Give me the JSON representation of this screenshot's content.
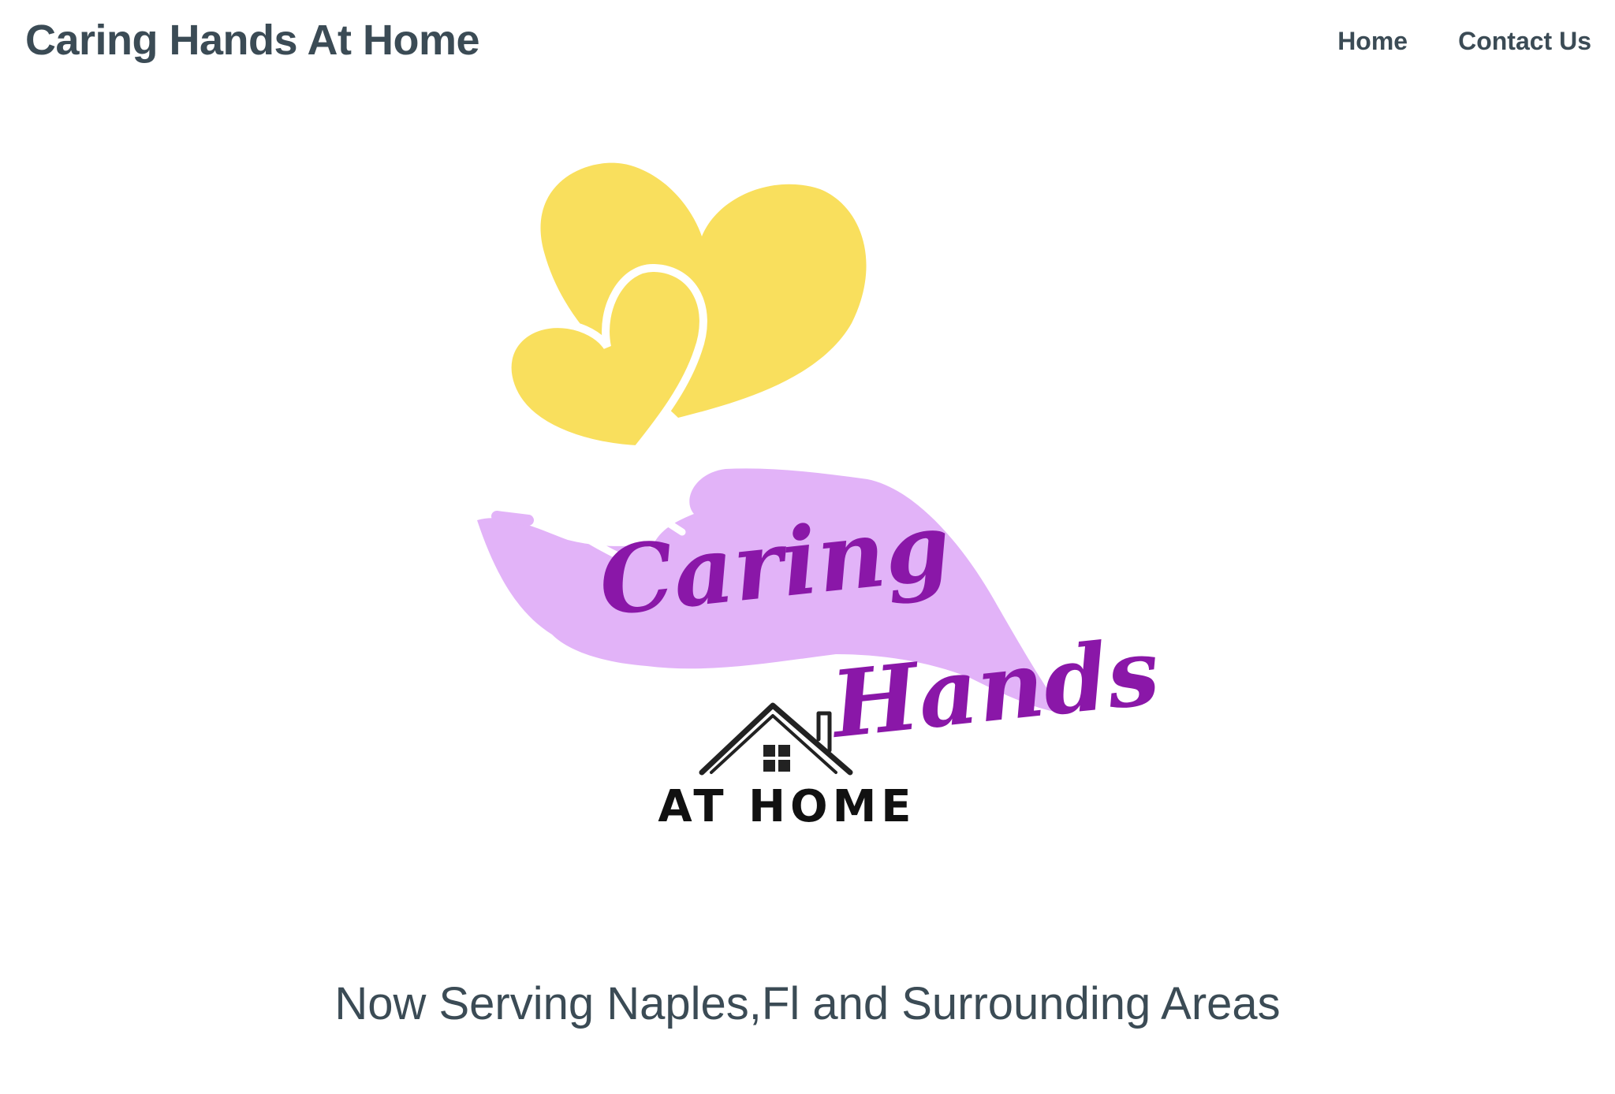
{
  "header": {
    "site_title": "Caring Hands At Home",
    "nav": [
      {
        "label": "Home"
      },
      {
        "label": "Contact Us"
      }
    ]
  },
  "logo": {
    "script_line_1": "Caring",
    "script_line_2": "Hands",
    "subtitle": "AT HOME",
    "colors": {
      "hearts": "#f9df5d",
      "hand": "#e2b3f8",
      "script": "#8a17a8",
      "house": "#222222"
    },
    "icons": [
      "large-heart-icon",
      "small-heart-icon",
      "open-hand-icon",
      "house-icon"
    ]
  },
  "main": {
    "tagline": "Now Serving Naples,Fl and Surrounding Areas"
  }
}
